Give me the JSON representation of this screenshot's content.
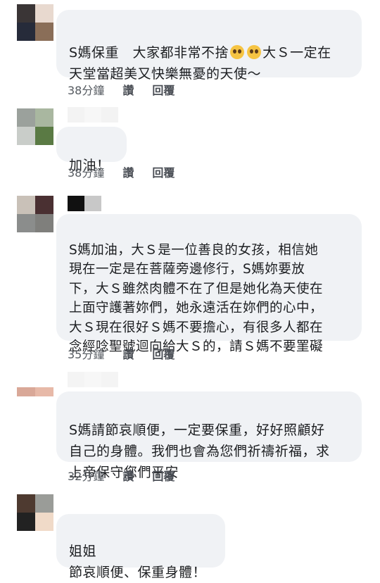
{
  "comments": [
    {
      "text_before_emoji": "S媽保重　大家都非常不捨",
      "emoji_names": [
        "pleading-face-emoji",
        "pleading-face-emoji"
      ],
      "text_after_emoji": "大Ｓ一定在\n天堂當超美又快樂無憂的天使～",
      "time": "38分鐘",
      "like": "讚",
      "reply": "回覆"
    },
    {
      "text": "加油！",
      "time": "38分鐘",
      "like": "讚",
      "reply": "回覆"
    },
    {
      "text": "S媽加油，大Ｓ是一位善良的女孩，相信她\n現在一定是在菩薩旁邊修行，S媽妳要放\n下，大Ｓ雖然肉體不在了但是她化為天使在\n上面守護著妳們，她永遠活在妳們的心中，\n大Ｓ現在很好Ｓ媽不要擔心，有很多人都在\n念經唸聖號迴向給大Ｓ的，請Ｓ媽不要罣礙",
      "time": "35分鐘",
      "like": "讚",
      "reply": "回覆"
    },
    {
      "text": "S媽請節哀順便，一定要保重，好好照顧好\n自己的身體。我們也會為您們祈禱祈福，求\n上帝保守您們平安",
      "time": "32分鐘",
      "like": "讚",
      "reply": "回覆"
    },
    {
      "text": "姐姐\n節哀順便、保重身體！"
    }
  ],
  "colors": {
    "bubble_bg": "#f0f2f5",
    "text": "#1c1e21",
    "meta": "#555a60"
  }
}
